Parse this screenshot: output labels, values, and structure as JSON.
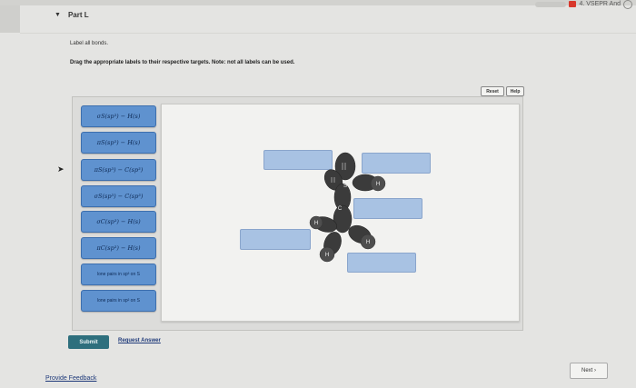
{
  "top_bar": {
    "tab_text": "4. VSEPR And"
  },
  "part": {
    "title": "Part L",
    "toggle_icon": "caret-down-icon"
  },
  "instructions": {
    "line1": "Label all bonds.",
    "line2": "Drag the appropriate labels to their respective targets. Note: not all labels can be used."
  },
  "toolbar": {
    "reset_label": "Reset",
    "help_label": "Help"
  },
  "labels": [
    "σS(sp³) − H(s)",
    "πS(sp³) − H(s)",
    "πS(sp³) − C(sp³)",
    "σS(sp³) − C(sp³)",
    "σC(sp³) − H(s)",
    "πC(sp³) − H(s)",
    "lone pairs in sp³ on S",
    "lone pairs in sp² on S"
  ],
  "molecule": {
    "atoms": [
      "S",
      "C",
      "H",
      "H",
      "H",
      "H"
    ]
  },
  "actions": {
    "submit_label": "Submit",
    "request_answer_label": "Request Answer"
  },
  "footer": {
    "feedback_label": "Provide Feedback",
    "next_label": "Next ›"
  },
  "colors": {
    "tile": "#5f92cf",
    "target": "#a8c2e3",
    "submit": "#2e6f7d",
    "orbital": "#3b3b3b"
  }
}
